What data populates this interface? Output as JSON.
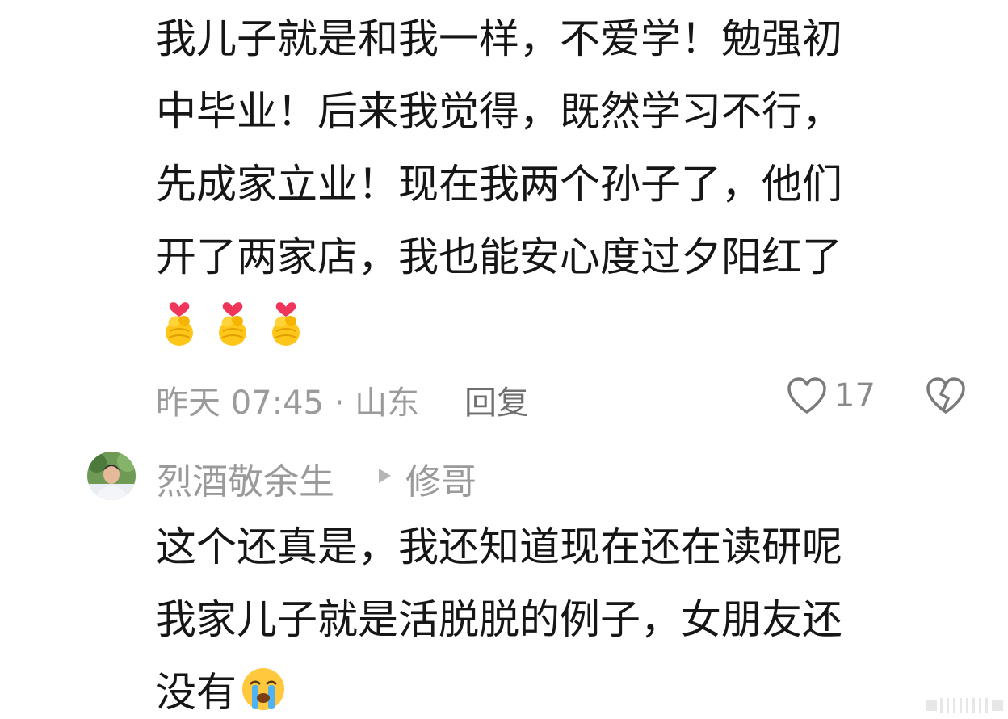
{
  "comment": {
    "lines": [
      "我儿子就是和我一样，不爱学！勉强初",
      "中毕业！后来我觉得，既然学习不行，",
      "先成家立业！现在我两个孙子了，他们",
      "开了两家店，我也能安心度过夕阳红了"
    ],
    "emojis": [
      "finger-heart-icon",
      "finger-heart-icon",
      "finger-heart-icon"
    ],
    "time_location": "昨天 07:45 · 山东",
    "reply_label": "回复",
    "like_count": "17"
  },
  "reply": {
    "username": "烈酒敬余生",
    "target_user": "修哥",
    "lines": [
      "这个还真是，我还知道现在还在读研呢",
      "我家儿子就是活脱脱的例子，女朋友还",
      "没有"
    ],
    "trailing_emoji": "crying-face-icon"
  },
  "colors": {
    "text": "#161616",
    "meta": "#9b9b9b",
    "icon": "#7a7a7a"
  }
}
